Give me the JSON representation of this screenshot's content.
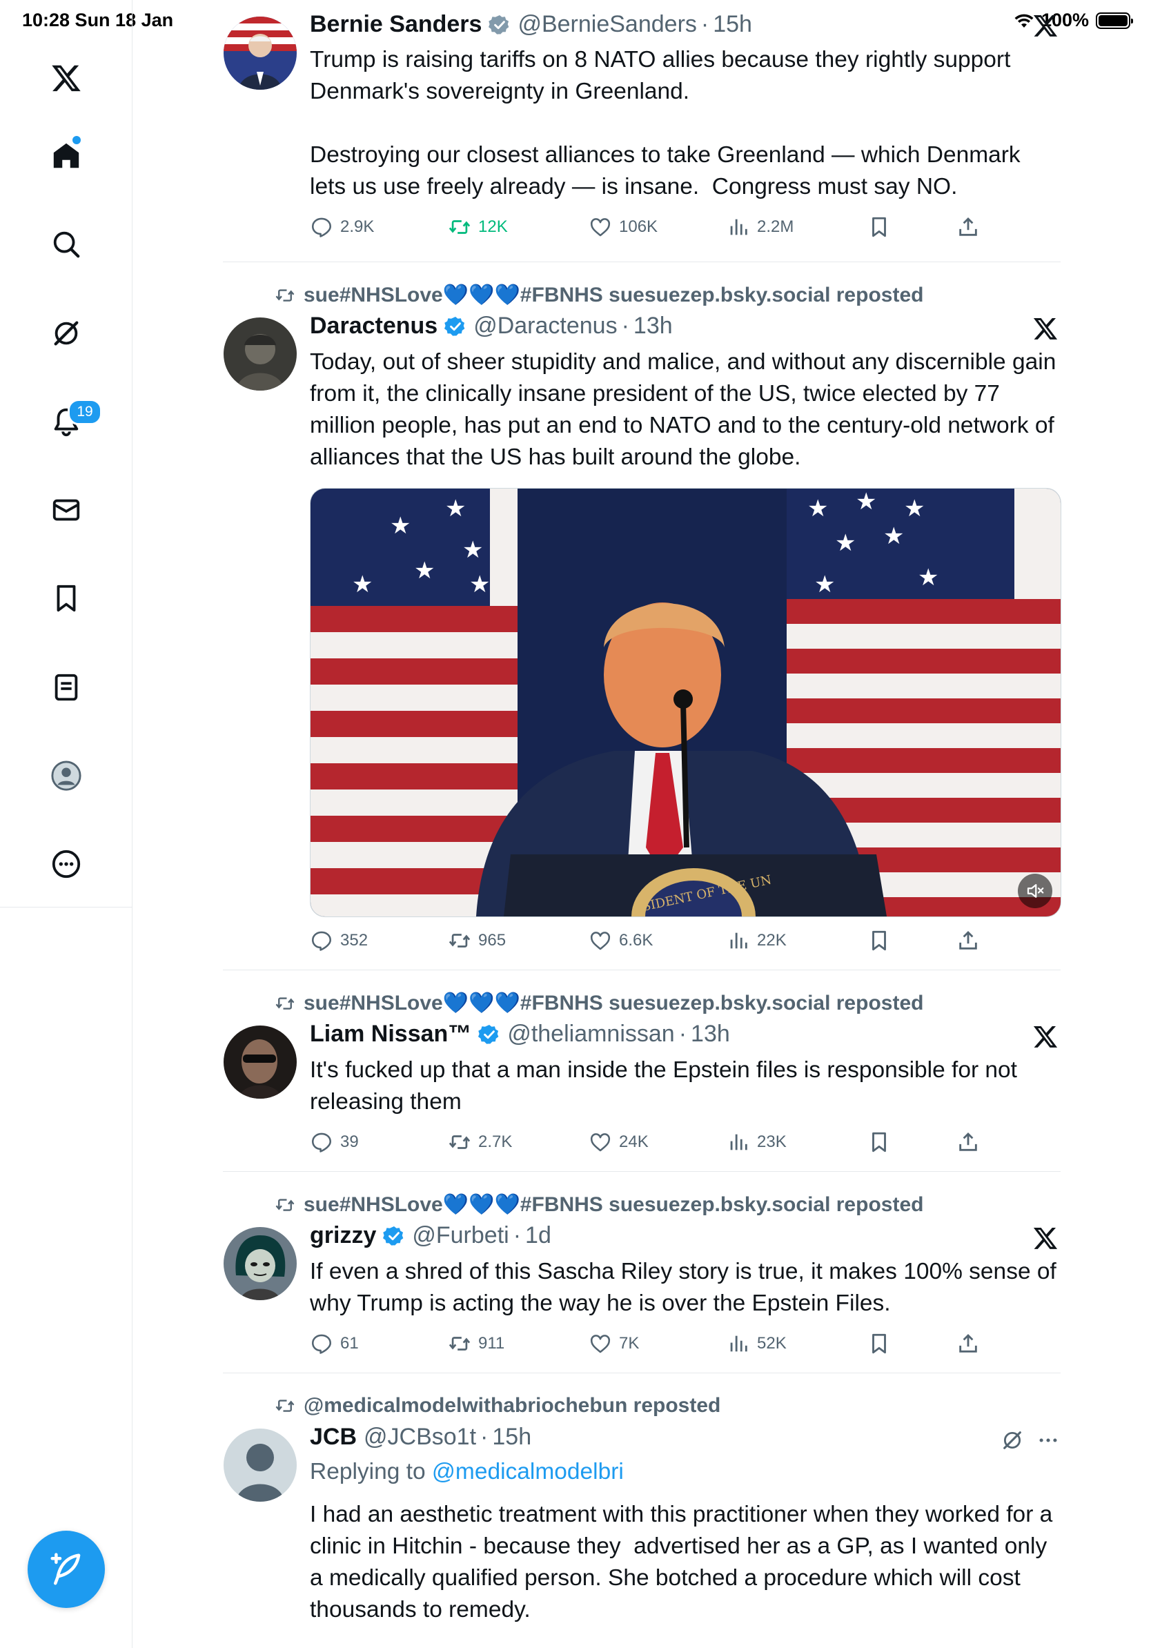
{
  "status": {
    "time_date": "10:28  Sun 18 Jan",
    "battery": "100%"
  },
  "sidebar": {
    "notifications_badge": "19",
    "items": [
      "x-logo",
      "home",
      "search",
      "grok",
      "notifications",
      "messages",
      "bookmarks",
      "lists",
      "profile",
      "more"
    ]
  },
  "colors": {
    "accent": "#1d9bf0",
    "repost_green": "#00ba7c",
    "secondary_text": "#536471"
  },
  "posts": [
    {
      "name": "Bernie Sanders",
      "verified": "grey",
      "handle": "@BernieSanders",
      "time": "15h",
      "text": "Trump is raising tariffs on 8 NATO allies because they rightly support Denmark's sovereignty in Greenland.\n\nDestroying our closest alliances to take Greenland — which Denmark lets us use freely already — is insane.  Congress must say NO.",
      "stats": {
        "replies": "2.9K",
        "reposts": "12K",
        "likes": "106K",
        "views": "2.2M"
      }
    },
    {
      "repost_by": "sue#NHSLove💙💙💙#FBNHS suesuezep.bsky.social reposted",
      "name": "Daractenus",
      "verified": "blue",
      "handle": "@Daractenus",
      "time": "13h",
      "text": "Today, out of sheer stupidity and malice, and without any discernible gain from it, the clinically insane president of the US, twice elected by 77 million people, has put an end to NATO and to the century-old network of alliances that the US has built around the globe.",
      "media_seal_text": "SIDENT OF THE UN",
      "stats": {
        "replies": "352",
        "reposts": "965",
        "likes": "6.6K",
        "views": "22K"
      }
    },
    {
      "repost_by": "sue#NHSLove💙💙💙#FBNHS suesuezep.bsky.social reposted",
      "name": "Liam Nissan™",
      "verified": "blue",
      "handle": "@theliamnissan",
      "time": "13h",
      "text": "It's fucked up that a man inside the Epstein files is responsible for not releasing them",
      "stats": {
        "replies": "39",
        "reposts": "2.7K",
        "likes": "24K",
        "views": "23K"
      }
    },
    {
      "repost_by": "sue#NHSLove💙💙💙#FBNHS suesuezep.bsky.social reposted",
      "name": "grizzy",
      "verified": "blue",
      "handle": "@Furbeti",
      "time": "1d",
      "text": "If even a shred of this Sascha Riley story is true, it makes 100% sense of why Trump is acting the way he is over the Epstein Files.",
      "stats": {
        "replies": "61",
        "reposts": "911",
        "likes": "7K",
        "views": "52K"
      }
    },
    {
      "repost_by": "@medicalmodelwithabriochebun reposted",
      "name": "JCB",
      "handle": "@JCBso1t",
      "time": "15h",
      "reply_prefix": "Replying to ",
      "reply_to": "@medicalmodelbri",
      "text": "I had an aesthetic treatment with this practitioner when they worked for a clinic in Hitchin - because they  advertised her as a GP, as I wanted only a medically qualified person. She botched a procedure which will cost thousands to remedy."
    }
  ]
}
